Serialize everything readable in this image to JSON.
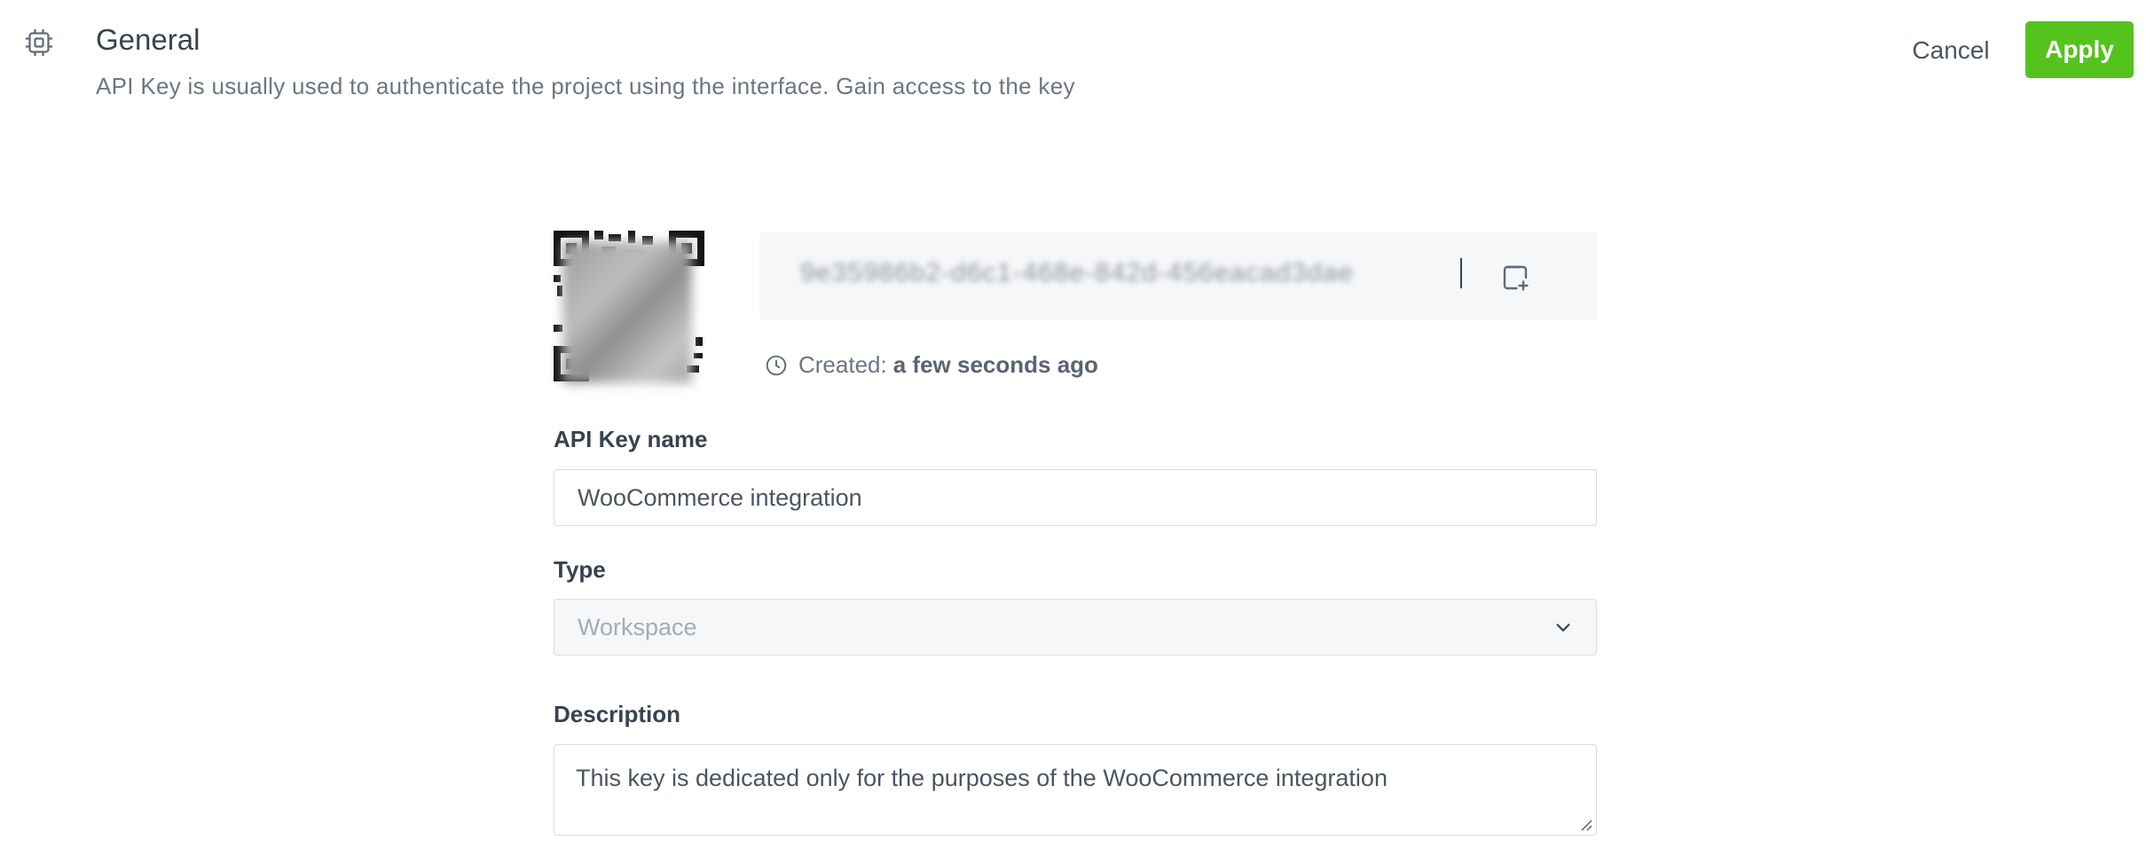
{
  "header": {
    "icon": "settings-chip-icon",
    "title": "General",
    "subtitle": "API Key is usually used to authenticate the project using the interface. Gain access to the key",
    "cancel_label": "Cancel",
    "apply_label": "Apply",
    "apply_color": "#54c31e"
  },
  "api_key": {
    "value": "9e35986b2-d6c1-468e-842d-456eacad3dae",
    "qr_icon": "qr-code",
    "copy_icon": "copy-icon",
    "created_label": "Created:",
    "created_value": "a few seconds ago"
  },
  "form": {
    "name_label": "API Key name",
    "name_value": "WooCommerce integration",
    "type_label": "Type",
    "type_value": "Workspace",
    "description_label": "Description",
    "description_value": "This key is dedicated only for the purposes of the WooCommerce integration"
  }
}
